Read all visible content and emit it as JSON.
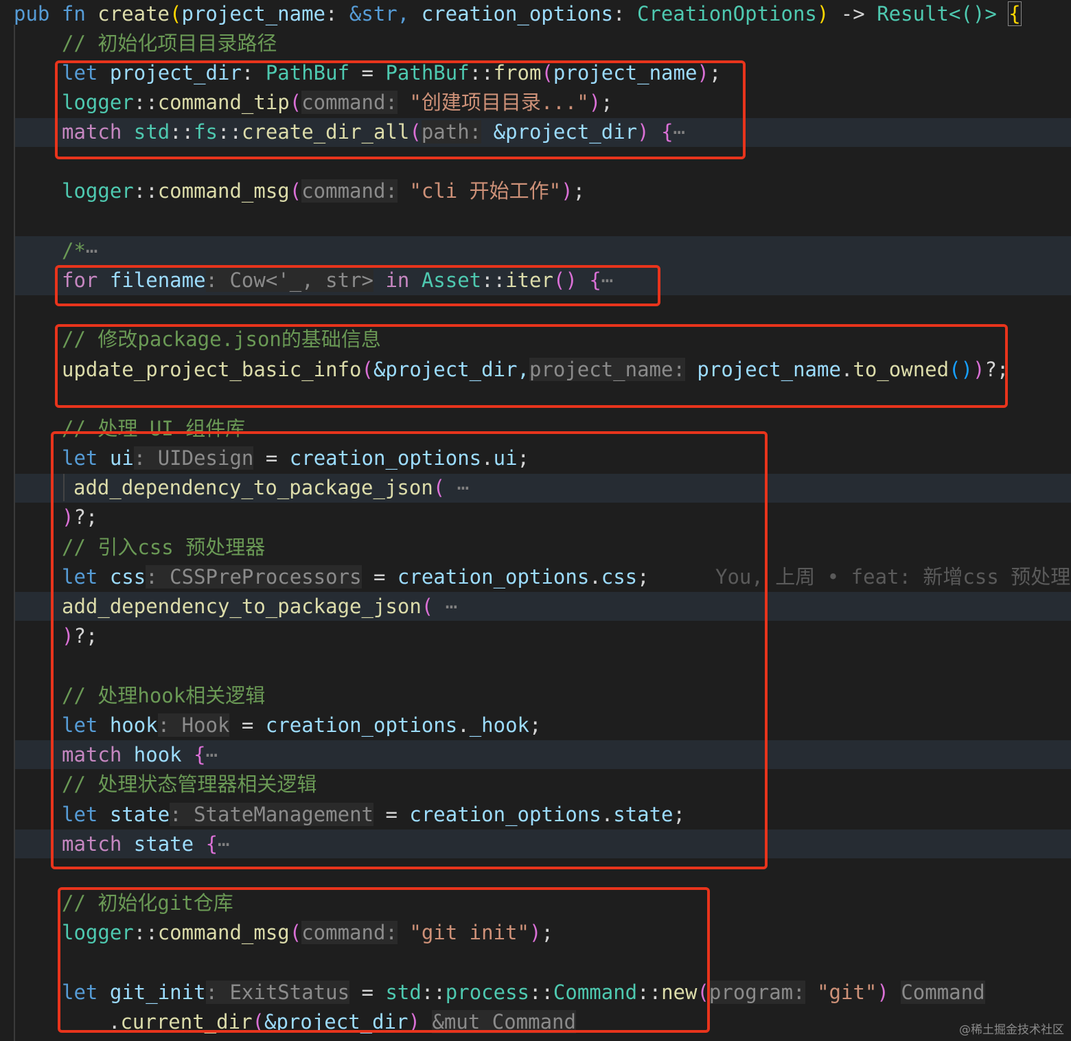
{
  "code": {
    "l1": {
      "pub": "pub",
      "fn": "fn",
      "name": "create",
      "p_open": "(",
      "arg1": "project_name",
      "colon1": ": ",
      "amp_str": "&str, ",
      "arg2": "creation_options",
      "colon2": ": ",
      "arg2_type": "CreationOptions",
      "p_close": ")",
      "arrow": " -> ",
      "ret": "Result<()>",
      "brace": "{"
    },
    "l2": {
      "comment": "// 初始化项目目录路径"
    },
    "l3": {
      "let": "let",
      "var": "project_dir",
      "colon": ": ",
      "type": "PathBuf",
      "eq": " = ",
      "type2": "PathBuf",
      "sep": "::",
      "fn": "from",
      "p_open": "(",
      "arg": "project_name",
      "p_close": ")",
      "end": ";"
    },
    "l4": {
      "mod": "logger",
      "sep": "::",
      "fn": "command_tip",
      "p_open": "(",
      "hint": "command:",
      "str": "\"创建项目目录...\"",
      "p_close": ")",
      "end": ";"
    },
    "l5": {
      "match": "match",
      "mod1": "std",
      "sep1": "::",
      "mod2": "fs",
      "sep2": "::",
      "fn": "create_dir_all",
      "p_open": "(",
      "hint": "path:",
      "arg": "&project_dir",
      "p_close": ")",
      "brace": "{",
      "fold": "⋯"
    },
    "l6": {
      "mod": "logger",
      "sep": "::",
      "fn": "command_msg",
      "p_open": "(",
      "hint": "command:",
      "str": "\"cli 开始工作\"",
      "p_close": ")",
      "end": ";"
    },
    "l7": {
      "comment": "/*",
      "fold": "⋯"
    },
    "l8": {
      "for": "for",
      "var": "filename",
      "colon": ": ",
      "type": "Cow<'_, str>",
      "in": "in",
      "type2": "Asset",
      "sep": "::",
      "fn": "iter",
      "parens": "()",
      "brace": "{",
      "fold": "⋯"
    },
    "l9": {
      "comment": "// 修改package.json的基础信息"
    },
    "l10": {
      "fn": "update_project_basic_info",
      "p_open": "(",
      "arg": "&project_dir,",
      "hint": "project_name:",
      "var": "project_name",
      "dot": ".",
      "fn2": "to_owned",
      "parens": "()",
      "p_close": ")",
      "end": "?;"
    },
    "l11": {
      "comment": "// 处理 UI 组件库"
    },
    "l12": {
      "let": "let",
      "var": "ui",
      "colon": ": ",
      "type": "UIDesign",
      "eq": " = ",
      "obj": "creation_options",
      "dot": ".",
      "field": "ui",
      "end": ";"
    },
    "l13": {
      "fn": "add_dependency_to_package_json",
      "p_open": "(",
      "fold": "⋯"
    },
    "l14": {
      "p_close": ")",
      "end": "?;"
    },
    "l15": {
      "comment": "// 引入css 预处理器"
    },
    "l16": {
      "let": "let",
      "var": "css",
      "colon": ": ",
      "type": "CSSPreProcessors",
      "eq": " = ",
      "obj": "creation_options",
      "dot": ".",
      "field": "css",
      "end": ";",
      "blame": "You, 上周 • feat: 新增css 预处理"
    },
    "l17": {
      "fn": "add_dependency_to_package_json",
      "p_open": "(",
      "fold": "⋯"
    },
    "l18": {
      "p_close": ")",
      "end": "?;"
    },
    "l19": {
      "comment": "// 处理hook相关逻辑"
    },
    "l20": {
      "let": "let",
      "var": "hook",
      "colon": ": ",
      "type": "Hook",
      "eq": " = ",
      "obj": "creation_options",
      "dot": ".",
      "field": "_hook",
      "end": ";"
    },
    "l21": {
      "match": "match",
      "var": "hook",
      "brace": "{",
      "fold": "⋯"
    },
    "l22": {
      "comment": "// 处理状态管理器相关逻辑"
    },
    "l23": {
      "let": "let",
      "var": "state",
      "colon": ": ",
      "type": "StateManagement",
      "eq": " = ",
      "obj": "creation_options",
      "dot": ".",
      "field": "state",
      "end": ";"
    },
    "l24": {
      "match": "match",
      "var": "state",
      "brace": "{",
      "fold": "⋯"
    },
    "l25": {
      "comment": "// 初始化git仓库"
    },
    "l26": {
      "mod": "logger",
      "sep": "::",
      "fn": "command_msg",
      "p_open": "(",
      "hint": "command:",
      "str": "\"git init\"",
      "p_close": ")",
      "end": ";"
    },
    "l27": {
      "let": "let",
      "var": "git_init",
      "colon": ": ",
      "type": "ExitStatus",
      "eq": " = ",
      "mod1": "std",
      "sep1": "::",
      "mod2": "process",
      "sep2": "::",
      "type2": "Command",
      "sep3": "::",
      "fn": "new",
      "p_open": "(",
      "hint": "program:",
      "str": "\"git\"",
      "p_close": ")",
      "inlay": "Command"
    },
    "l28": {
      "dot": ".",
      "fn": "current_dir",
      "p_open": "(",
      "arg": "&project_dir",
      "p_close": ")",
      "inlay": "&mut Command"
    }
  },
  "watermark": "@稀土掘金技术社区",
  "colors": {
    "highlight_box": "#e8341c",
    "background": "#1e1e1e"
  }
}
